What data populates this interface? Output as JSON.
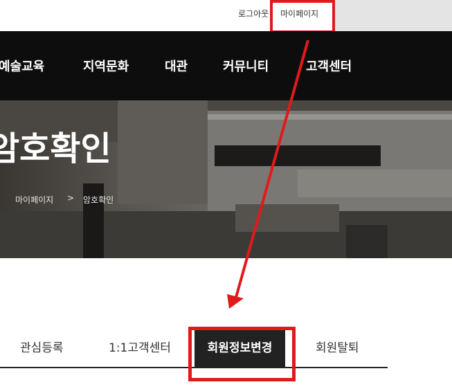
{
  "topbar": {
    "logout_label": "로그아웃",
    "mypage_label": "마이페이지"
  },
  "nav": {
    "items": [
      "예술교육",
      "지역문화",
      "대관",
      "커뮤니티",
      "고객센터"
    ]
  },
  "hero": {
    "title": "암호확인",
    "breadcrumb": [
      "마이페이지",
      "암호확인"
    ],
    "breadcrumb_separator": ">"
  },
  "tabs": {
    "items": [
      "관심등록",
      "1:1고객센터",
      "회원정보변경",
      "회원탈퇴"
    ],
    "active_index": 2
  },
  "colors": {
    "highlight": "#e01a1a",
    "nav_bg": "#0e0d0d",
    "active_tab_bg": "#222222"
  }
}
